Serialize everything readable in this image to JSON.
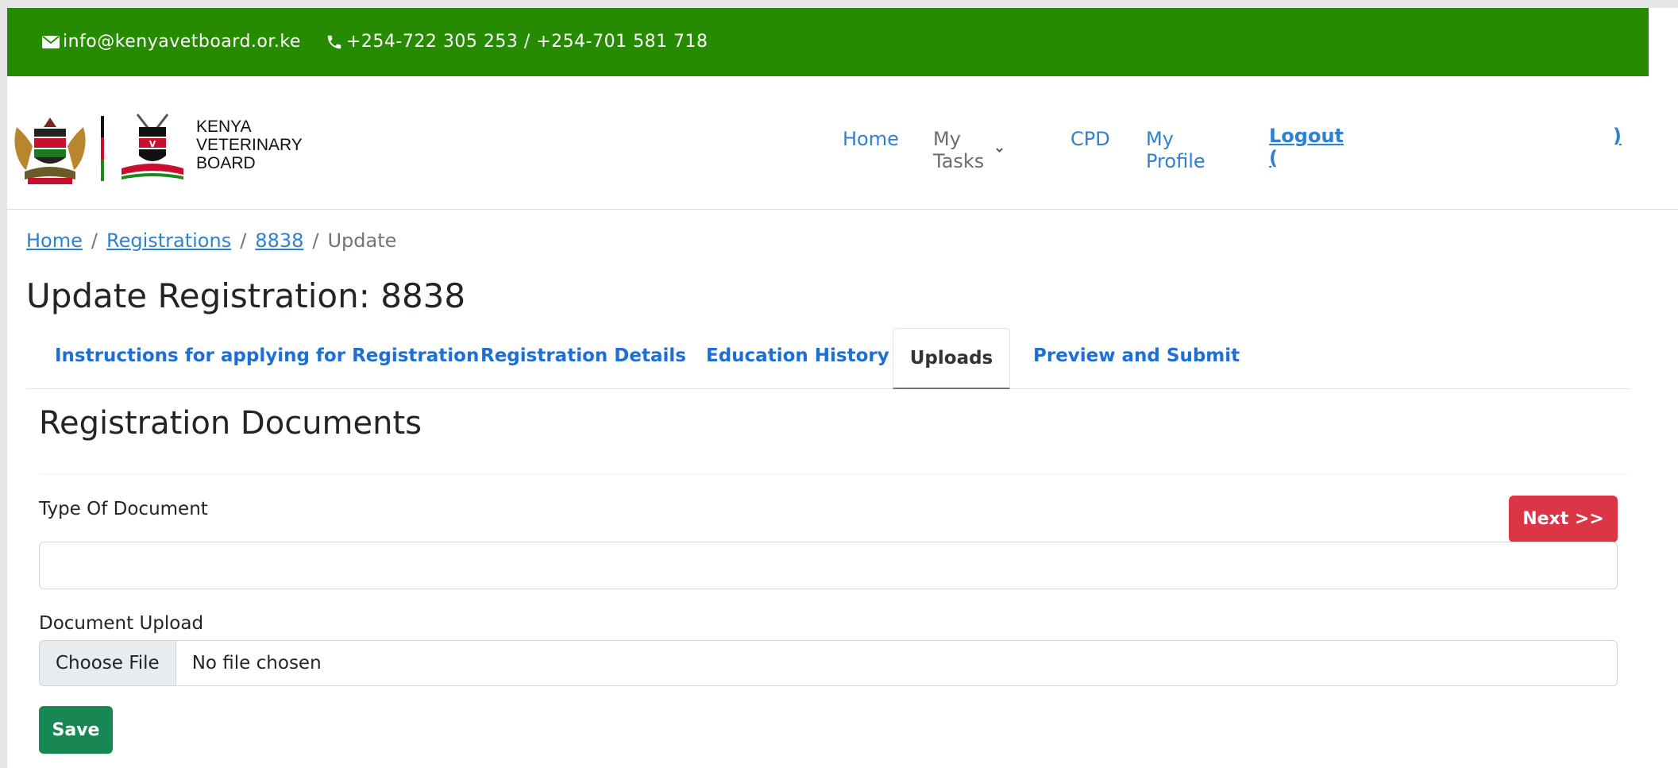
{
  "topbar": {
    "email": "info@kenyavetboard.or.ke",
    "phone": "+254-722 305 253 / +254-701 581 718",
    "email_icon": "envelope-icon",
    "phone_icon": "phone-icon"
  },
  "brand": {
    "line1": "KENYA",
    "line2": "VETERINARY",
    "line3": "BOARD"
  },
  "nav": {
    "home": "Home",
    "tasks": "My Tasks",
    "cpd": "CPD",
    "profile": "My Profile",
    "logout_open": "Logout (",
    "logout_close": ")"
  },
  "breadcrumb": {
    "home": "Home",
    "registrations": "Registrations",
    "id": "8838",
    "current": "Update",
    "separator": "/"
  },
  "page_title": "Update Registration: 8838",
  "tabs": [
    {
      "label": "Instructions for applying for Registration"
    },
    {
      "label": "Registration Details"
    },
    {
      "label": "Education History"
    },
    {
      "label": "Uploads"
    },
    {
      "label": "Preview and Submit"
    }
  ],
  "section_title": "Registration Documents",
  "form": {
    "type_label": "Type Of Document",
    "next_label": "Next >>",
    "upload_label": "Document Upload",
    "choose_file": "Choose File",
    "no_file": "No file chosen",
    "save_label": "Save"
  },
  "colors": {
    "topbar": "#268b00",
    "link": "#2f80d1",
    "next": "#dc3545",
    "save": "#198754"
  }
}
